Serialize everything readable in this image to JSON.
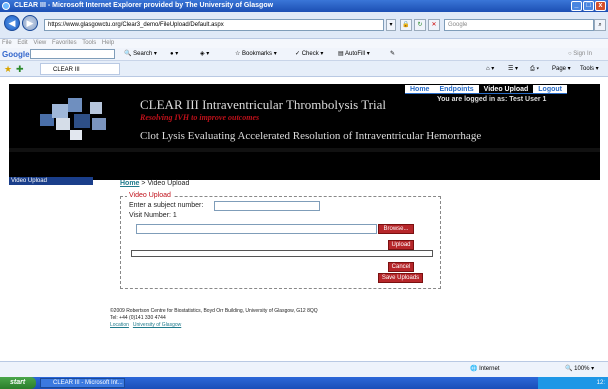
{
  "window": {
    "title": "CLEAR III - Microsoft Internet Explorer provided by The University of Glasgow",
    "minimize": "_",
    "maximize": "□",
    "close": "x"
  },
  "addressbar": {
    "url": "https://www.glasgowctu.org/Clear3_demo/FileUpload/Default.aspx",
    "search_placeholder": "Google"
  },
  "menubar": {
    "items": [
      "File",
      "Edit",
      "View",
      "Favorites",
      "Tools",
      "Help"
    ]
  },
  "google_toolbar": {
    "logo": "Google",
    "search_label": "Search",
    "bookmarks_label": "Bookmarks",
    "check_label": "Check",
    "autofill_label": "AutoFill",
    "signin_label": "Sign In"
  },
  "favorites_bar": {
    "tab_label": "CLEAR III",
    "page_label": "Page",
    "tools_label": "Tools"
  },
  "site_nav": {
    "items": [
      "Home",
      "Endpoints",
      "Video Upload",
      "Logout"
    ],
    "active": "Video Upload"
  },
  "banner": {
    "title": "CLEAR III Intraventricular Thrombolysis Trial",
    "subtitle": "Resolving IVH to improve outcomes",
    "clot_line": "Clot Lysis Evaluating Accelerated Resolution of Intraventricular Hemorrhage",
    "logged_in": "You are logged in as: Test User 1"
  },
  "sidebar": {
    "item": "Video Upload"
  },
  "breadcrumb": {
    "home": "Home",
    "separator": " > ",
    "current": "Video Upload"
  },
  "upload_form": {
    "legend": "Video Upload",
    "subject_label": "Enter a subject number:",
    "subject_value": "",
    "visit_label": "Visit Number: 1",
    "browse_label": "Browse...",
    "upload_label": "Upload",
    "cancel_label": "Cancel",
    "save_label": "Save Uploads"
  },
  "footer": {
    "line1": "©2009 Robertson Centre for Biostatistics, Boyd Orr Building, University of Glasgow, G12 8QQ",
    "line2": "Tel: +44 (0)141 330 4744",
    "location_link": "Location",
    "university_link": "University of Glasgow"
  },
  "statusbar": {
    "zone": "Internet",
    "zoom": "100%"
  },
  "taskbar": {
    "start": "start",
    "task_item": "CLEAR III - Microsoft Int...",
    "time": "12:"
  },
  "colors": {
    "accent_red": "#b6262a",
    "link_teal": "#1f7a8c",
    "banner_black": "#000000",
    "sidebar_blue": "#1a3e8a"
  }
}
